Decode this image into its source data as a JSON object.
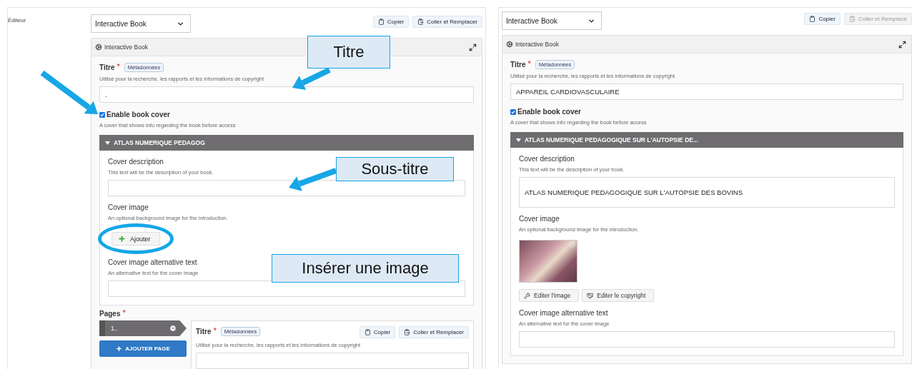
{
  "annotations": [
    {
      "kind": "callout",
      "text": "Titre"
    },
    {
      "kind": "callout",
      "text": "Sous-titre"
    },
    {
      "kind": "callout",
      "text": "Insérer une image"
    }
  ],
  "editors": [
    {
      "side_label": "Éditeur",
      "select": "Interactive Book",
      "actions": [
        {
          "label": "Copier",
          "disabled": false
        },
        {
          "label": "Coller et Remplacer",
          "disabled": false
        }
      ],
      "panel_title": "Interactive Book",
      "title_field": {
        "label": "Titre",
        "required_mark": "*",
        "tag": "Métadonnées",
        "hint": "Utilisé pour la recherche, les rapports et les informations de copyright",
        "value": "."
      },
      "cover_toggle": {
        "label": "Enable book cover",
        "checked": true,
        "hint": "A cover that shows info regarding the book before access"
      },
      "group": {
        "title": "ATLAS NUMERIQUE PEDAGOG",
        "expanded": true,
        "fields": [
          {
            "kind": "text",
            "label": "Cover description",
            "hint": "This text will be the description of your book."
          },
          {
            "kind": "image",
            "label": "Cover image",
            "hint": "An optional background image for the introduction.",
            "add_button": "Ajouter",
            "highlighted": true,
            "has_image": false
          },
          {
            "kind": "text",
            "label": "Cover image alternative text",
            "hint": "An alternative text for the cover image"
          }
        ]
      },
      "pages": {
        "label": "Pages",
        "required_mark": "*",
        "items": [
          {
            "label": "1..",
            "selected": true
          }
        ],
        "add_button": "AJOUTER PAGE",
        "page_title": {
          "label": "Titre",
          "required_mark": "*",
          "tag": "Métadonnées",
          "hint": "Utilisé pour la recherche, les rapports et les informations de copyright",
          "actions": [
            {
              "label": "Copier",
              "disabled": false
            },
            {
              "label": "Coller et Remplacer",
              "disabled": false
            }
          ]
        }
      }
    },
    {
      "select": "Interactive Book",
      "actions": [
        {
          "label": "Copier",
          "disabled": false
        },
        {
          "label": "Coller et Remplace",
          "disabled": true
        }
      ],
      "panel_title": "Interactive Book",
      "title_field": {
        "label": "Titre",
        "required_mark": "*",
        "tag": "Métadonnées",
        "hint": "Utilisé pour la recherche, les rapports et les informations de copyright",
        "value": "APPAREIL CARDIOVASCULAIRE"
      },
      "cover_toggle": {
        "label": "Enable book cover",
        "checked": true,
        "hint": "A cover that shows info regarding the book before access"
      },
      "group": {
        "title": "ATLAS NUMERIQUE PEDAGOGIQUE SUR L'AUTOPSIE DE...",
        "expanded": true,
        "fields": [
          {
            "kind": "textarea",
            "label": "Cover description",
            "hint": "This text will be the description of your book.",
            "value": "ATLAS NUMERIQUE PEDAGOGIQUE SUR L'AUTOPSIE DES BOVINS"
          },
          {
            "kind": "image",
            "label": "Cover image",
            "hint": "An optional background image for the introduction.",
            "highlighted": false,
            "has_image": true,
            "image_buttons": [
              "Editer l'image",
              "Editer le copyright"
            ]
          },
          {
            "kind": "text",
            "label": "Cover image alternative text",
            "hint": "An alternative text for the cover image"
          }
        ]
      }
    }
  ]
}
